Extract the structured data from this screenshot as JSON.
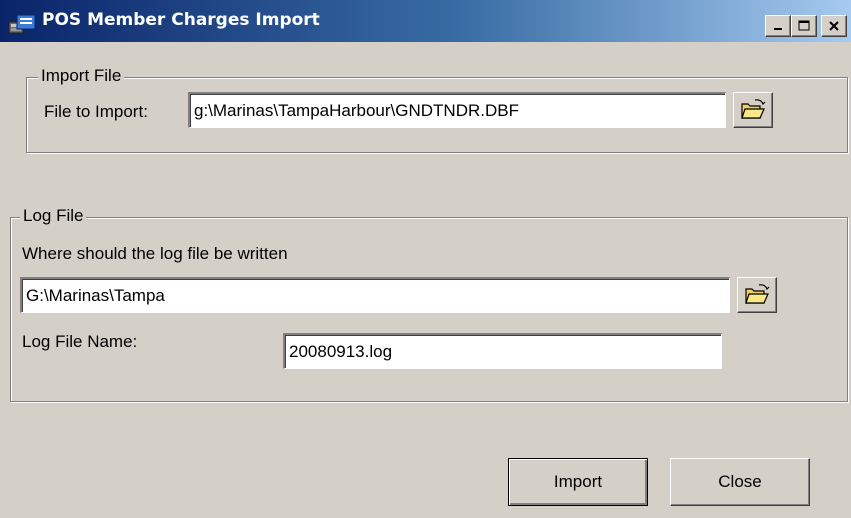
{
  "window": {
    "title": "POS Member Charges Import",
    "controls": {
      "minimize_icon": "minimize-icon",
      "maximize_icon": "maximize-icon",
      "close_icon": "close-icon"
    }
  },
  "import_file": {
    "group_label": "Import File",
    "field_label": "File to Import:",
    "value": "g:\\Marinas\\TampaHarbour\\GNDTNDR.DBF",
    "browse_icon": "open-folder-icon"
  },
  "log_file": {
    "group_label": "Log File",
    "location_label": "Where should the log file be written",
    "location_value": "G:\\Marinas\\Tampa",
    "browse_icon": "open-folder-icon",
    "name_label": "Log File Name:",
    "name_value": "20080913.log"
  },
  "buttons": {
    "import_label": "Import",
    "close_label": "Close"
  },
  "colors": {
    "title_start": "#0a246a",
    "title_end": "#a6caf0",
    "face": "#d4d0c8"
  }
}
